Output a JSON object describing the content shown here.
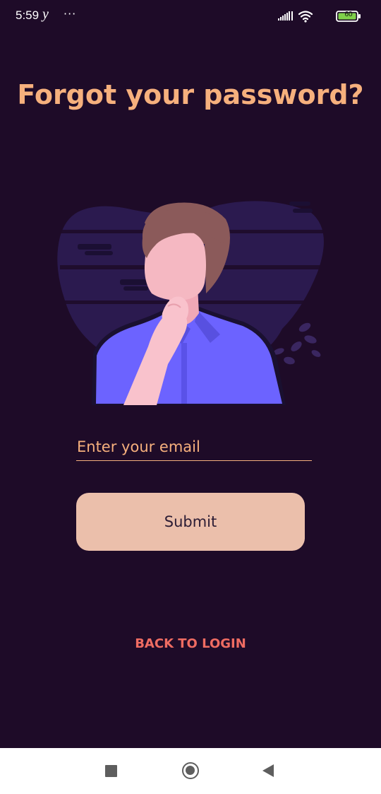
{
  "status_bar": {
    "time": "5:59",
    "carrier_glyph": "y",
    "more": "···",
    "battery": "60",
    "icons": [
      "signal-icon",
      "wifi-icon",
      "battery-icon"
    ]
  },
  "screen": {
    "title": "Forgot your password?",
    "illustration": "person-thinking-illustration",
    "email": {
      "placeholder": "Enter your email",
      "value": ""
    },
    "submit_label": "Submit",
    "back_label": "BACK TO LOGIN"
  },
  "nav_bar": {
    "icons": [
      "recents-icon",
      "home-icon",
      "back-icon"
    ]
  },
  "colors": {
    "background": "#1e0b28",
    "accent": "#f6b07d",
    "button": "#ebbfab",
    "link": "#ef6c62"
  }
}
